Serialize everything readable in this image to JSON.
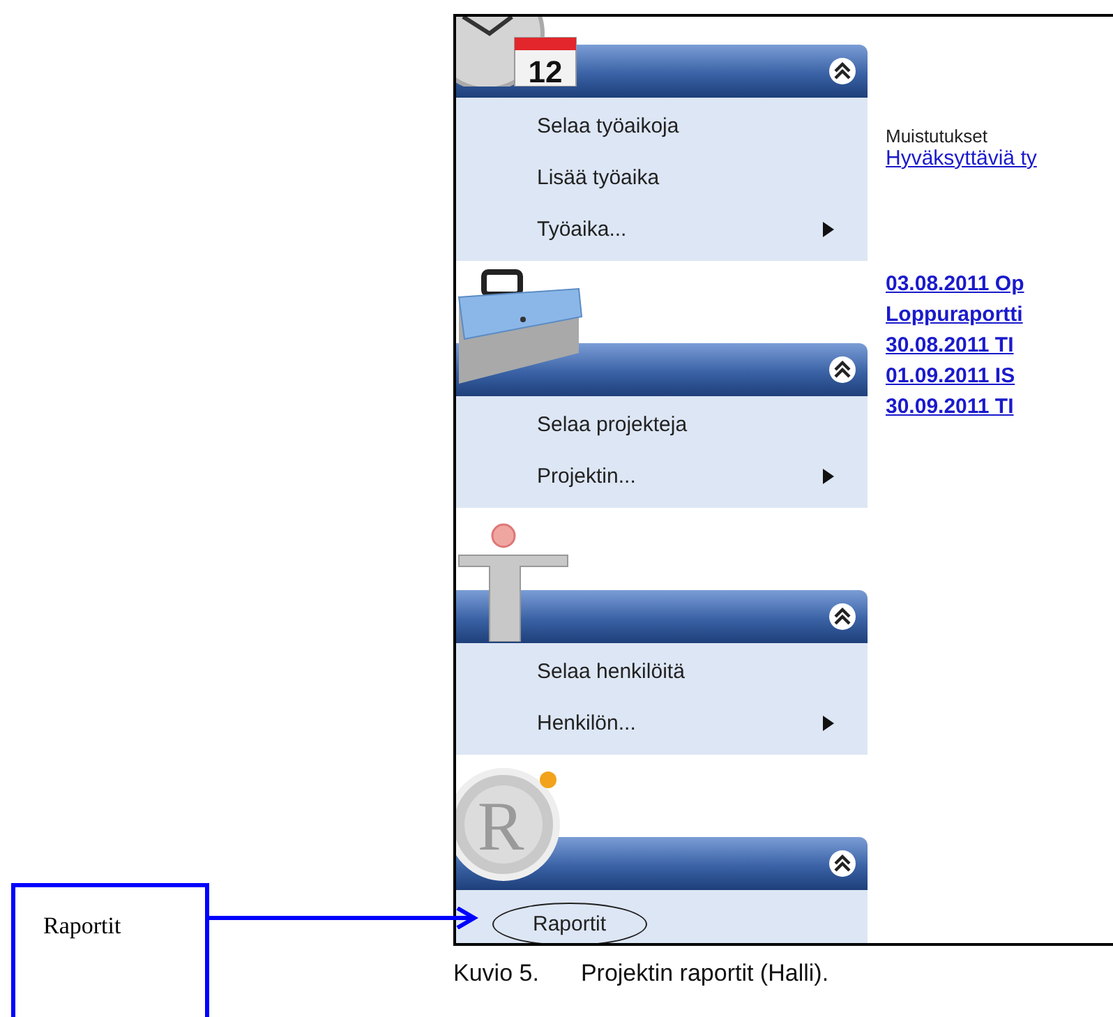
{
  "sections": [
    {
      "kind": "calendar",
      "calendar_day": "12",
      "expanded": true,
      "items": [
        {
          "label": "Selaa työaikoja",
          "kind": "link"
        },
        {
          "label": "Lisää työaika",
          "kind": "link"
        },
        {
          "label": "Työaika...",
          "kind": "submenu"
        }
      ]
    },
    {
      "kind": "briefcase",
      "expanded": true,
      "items": [
        {
          "label": "Selaa projekteja",
          "kind": "link"
        },
        {
          "label": "Projektin...",
          "kind": "submenu"
        }
      ]
    },
    {
      "kind": "person",
      "expanded": true,
      "items": [
        {
          "label": "Selaa henkilöitä",
          "kind": "link"
        },
        {
          "label": "Henkilön...",
          "kind": "submenu"
        }
      ]
    },
    {
      "kind": "report",
      "logo_letter": "R",
      "expanded": true,
      "items": [
        {
          "label": "Raportit",
          "kind": "link",
          "circled": true
        }
      ]
    }
  ],
  "reminders": {
    "heading": "Muistutukset",
    "link": "Hyväksyttäviä ty"
  },
  "deadlines": [
    "03.08.2011 Op",
    "Loppuraportti",
    "30.08.2011 TI",
    "01.09.2011 IS",
    "30.09.2011 TI"
  ],
  "callout": {
    "label": "Raportit"
  },
  "caption": {
    "number": "Kuvio 5.",
    "title": "Projektin raportit (Halli)."
  }
}
